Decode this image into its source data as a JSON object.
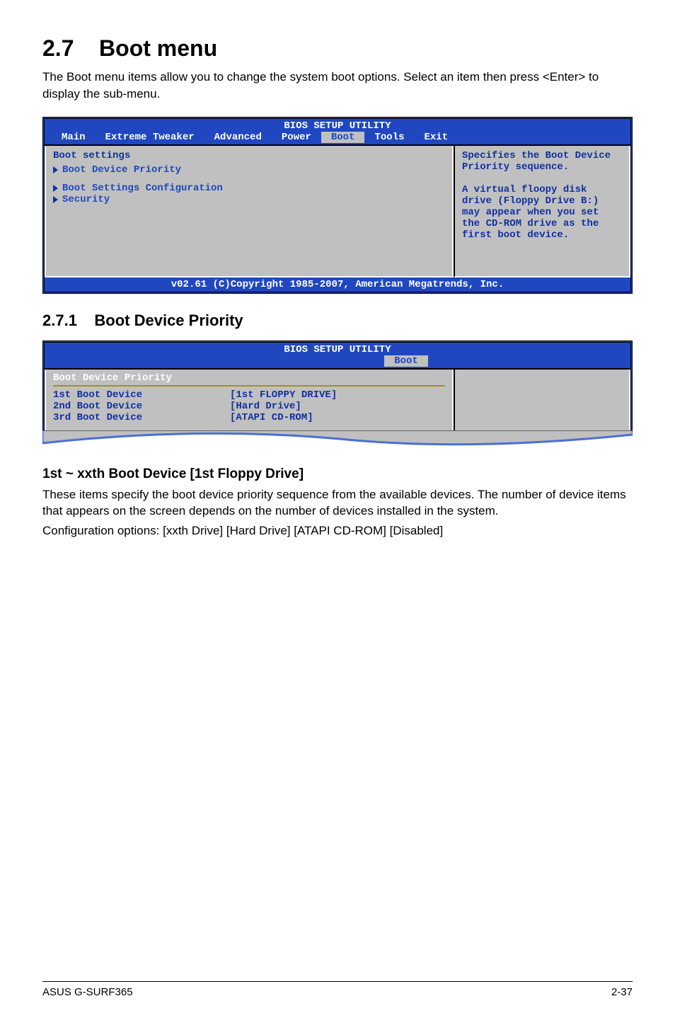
{
  "section": {
    "number": "2.7",
    "title": "Boot menu",
    "intro": "The Boot menu items allow you to change the system boot options. Select an item then press <Enter> to display the sub-menu."
  },
  "bios1": {
    "title": "BIOS SETUP UTILITY",
    "tabs": [
      "Main",
      "Extreme Tweaker",
      "Advanced",
      "Power",
      "Boot",
      "Tools",
      "Exit"
    ],
    "selected_tab": "Boot",
    "left_heading": "Boot settings",
    "items": [
      "Boot Device Priority",
      "Boot Settings Configuration",
      "Security"
    ],
    "help": "Specifies the Boot Device Priority sequence.\n\nA virtual floopy disk drive (Floppy Drive B:) may appear when you set the CD-ROM drive as the first boot device.",
    "footer": "v02.61 (C)Copyright 1985-2007, American Megatrends, Inc."
  },
  "sub": {
    "number": "2.7.1",
    "title": "Boot Device Priority"
  },
  "bios2": {
    "title": "BIOS SETUP UTILITY",
    "tab": "Boot",
    "heading": "Boot Device Priority",
    "rows": [
      {
        "label": "1st Boot Device",
        "value": "[1st FLOPPY DRIVE]"
      },
      {
        "label": "2nd Boot Device",
        "value": "[Hard Drive]"
      },
      {
        "label": "3rd Boot Device",
        "value": "[ATAPI CD-ROM]"
      }
    ]
  },
  "body": {
    "heading": "1st ~ xxth Boot Device [1st Floppy Drive]",
    "p1": "These items specify the boot device priority sequence from the available devices. The number of device items that appears on the screen depends on the number of devices installed in the system.",
    "p2": "Configuration options: [xxth Drive] [Hard Drive] [ATAPI CD-ROM] [Disabled]"
  },
  "footer": {
    "left": "ASUS G-SURF365",
    "right": "2-37"
  }
}
